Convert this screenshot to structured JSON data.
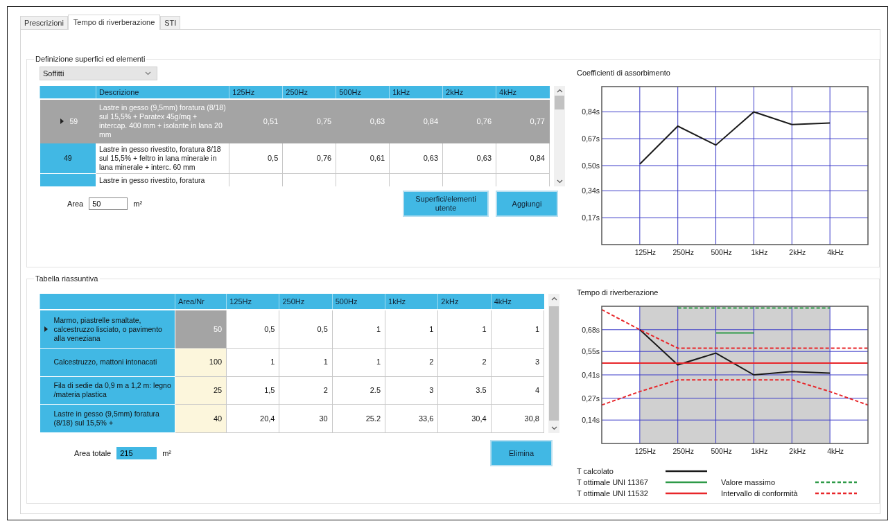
{
  "tabs": [
    {
      "label": "Prescrizioni",
      "selected": false
    },
    {
      "label": "Tempo di riverberazione",
      "selected": true
    },
    {
      "label": "STI",
      "selected": false
    }
  ],
  "surfaces": {
    "title": "Definizione superfici ed elementi",
    "category": "Soffitti",
    "table": {
      "columns": [
        "Descrizione",
        "125Hz",
        "250Hz",
        "500Hz",
        "1kHz",
        "2kHz",
        "4kHz"
      ],
      "rows": [
        {
          "code": "59",
          "description": "Lastre in gesso (9,5mm) foratura (8/18) sul 15,5% + Paratex 45g/mq + intercap. 400 mm + isolante in lana 20 mm",
          "values": [
            "0,51",
            "0,75",
            "0,63",
            "0,84",
            "0,76",
            "0,77"
          ],
          "selected": true
        },
        {
          "code": "49",
          "description": "Lastre in gesso rivestito, foratura 8/18 sul 15,5% + feltro in lana minerale in lana minerale + interc. 60 mm",
          "values": [
            "0,5",
            "0,76",
            "0,61",
            "0,63",
            "0,63",
            "0,84"
          ],
          "selected": false
        },
        {
          "description": "Lastre in gesso rivestito, foratura",
          "selected": false
        }
      ]
    },
    "area": {
      "label": "Area",
      "value": "50",
      "unit": "m²"
    },
    "buttons": [
      "Superfici/elementi utente",
      "Aggiungi"
    ]
  },
  "absorption_chart": {
    "chart_data": {
      "type": "line",
      "title": "Coefficienti di assorbimento",
      "categories": [
        null,
        "125Hz",
        "250Hz",
        "500Hz",
        "1kHz",
        "2kHz",
        "4kHz",
        null
      ],
      "ylim": [
        0,
        1.0
      ],
      "grid": true,
      "yticks": [
        {
          "value": 0.17,
          "label": "0,17s"
        },
        {
          "value": 0.34,
          "label": "0,34s"
        },
        {
          "value": 0.5,
          "label": "0,50s"
        },
        {
          "value": 0.67,
          "label": "0,67s"
        },
        {
          "value": 0.84,
          "label": "0,84s"
        }
      ],
      "series": [
        {
          "color": "#1a1a1a",
          "values": [
            null,
            0.51,
            0.75,
            0.63,
            0.84,
            0.76,
            0.77,
            null
          ]
        }
      ]
    }
  },
  "summary": {
    "title": "Tabella riassuntiva",
    "table": {
      "columns": [
        "Area/Nr",
        "125Hz",
        "250Hz",
        "500Hz",
        "1kHz",
        "2kHz",
        "4kHz"
      ],
      "rows": [
        {
          "description": "Marmo, piastrelle smaltate, calcestruzzo lisciato, o pavimento alla veneziana",
          "area": "50",
          "values": [
            "0,5",
            "0,5",
            "1",
            "1",
            "1",
            "1"
          ],
          "selected": true
        },
        {
          "description": "Calcestruzzo, mattoni intonacati",
          "area": "100",
          "values": [
            "1",
            "1",
            "1",
            "2",
            "2",
            "3"
          ],
          "selected": false
        },
        {
          "description": "Fila di sedie da 0,9 m a 1,2 m: legno /materia plastica",
          "area": "25",
          "values": [
            "1,5",
            "2",
            "2.5",
            "3",
            "3.5",
            "4"
          ],
          "selected": false
        },
        {
          "description": "Lastre in gesso (9,5mm) foratura (8/18) sul 15,5% +",
          "area": "40",
          "values": [
            "20,4",
            "30",
            "25.2",
            "33,6",
            "30,4",
            "30,8"
          ],
          "selected": false
        }
      ]
    },
    "total": {
      "label": "Area totale",
      "value": "215",
      "unit": "m²"
    },
    "buttons": [
      "Elimina"
    ]
  },
  "reverberation_chart": {
    "chart_data": {
      "type": "line",
      "title": "Tempo di riverberazione",
      "categories": [
        null,
        "125Hz",
        "250Hz",
        "500Hz",
        "1kHz",
        "2kHz",
        "4kHz",
        null
      ],
      "ylim": [
        0,
        0.82
      ],
      "grid": true,
      "yticks": [
        {
          "value": 0.14,
          "label": "0,14s"
        },
        {
          "value": 0.27,
          "label": "0,27s"
        },
        {
          "value": 0.41,
          "label": "0,41s"
        },
        {
          "value": 0.55,
          "label": "0,55s"
        },
        {
          "value": 0.68,
          "label": "0,68s"
        }
      ],
      "series": [
        {
          "name": "T calcolato",
          "color": "#1a1a1a",
          "line_style": "solid",
          "values": [
            null,
            0.68,
            0.47,
            0.54,
            0.41,
            0.43,
            0.42,
            null
          ]
        },
        {
          "name": "T ottimale UNI 11367",
          "color": "#2e9a48",
          "line_style": "solid",
          "values": [
            null,
            null,
            null,
            0.66,
            0.66,
            null,
            null,
            null
          ]
        },
        {
          "name": "T ottimale UNI 11532",
          "color": "#e8262a",
          "line_style": "solid",
          "values": [
            0.48,
            0.48,
            0.48,
            0.48,
            0.48,
            0.48,
            0.48,
            0.48
          ]
        },
        {
          "name": "Valore massimo",
          "color": "#2e9a48",
          "line_style": "dashed",
          "values": [
            null,
            null,
            0.81,
            0.81,
            0.81,
            0.81,
            0.81,
            null
          ]
        },
        {
          "name": "Intervallo di conformità",
          "color": "#e8262a",
          "line_style": "dashed",
          "values": [
            0.8,
            0.68,
            0.57,
            0.57,
            0.57,
            0.57,
            0.57,
            0.57
          ]
        },
        {
          "color": "#e8262a",
          "line_style": "dashed",
          "values": [
            0.23,
            0.31,
            0.38,
            0.38,
            0.38,
            0.38,
            0.31,
            0.23
          ]
        }
      ]
    }
  }
}
